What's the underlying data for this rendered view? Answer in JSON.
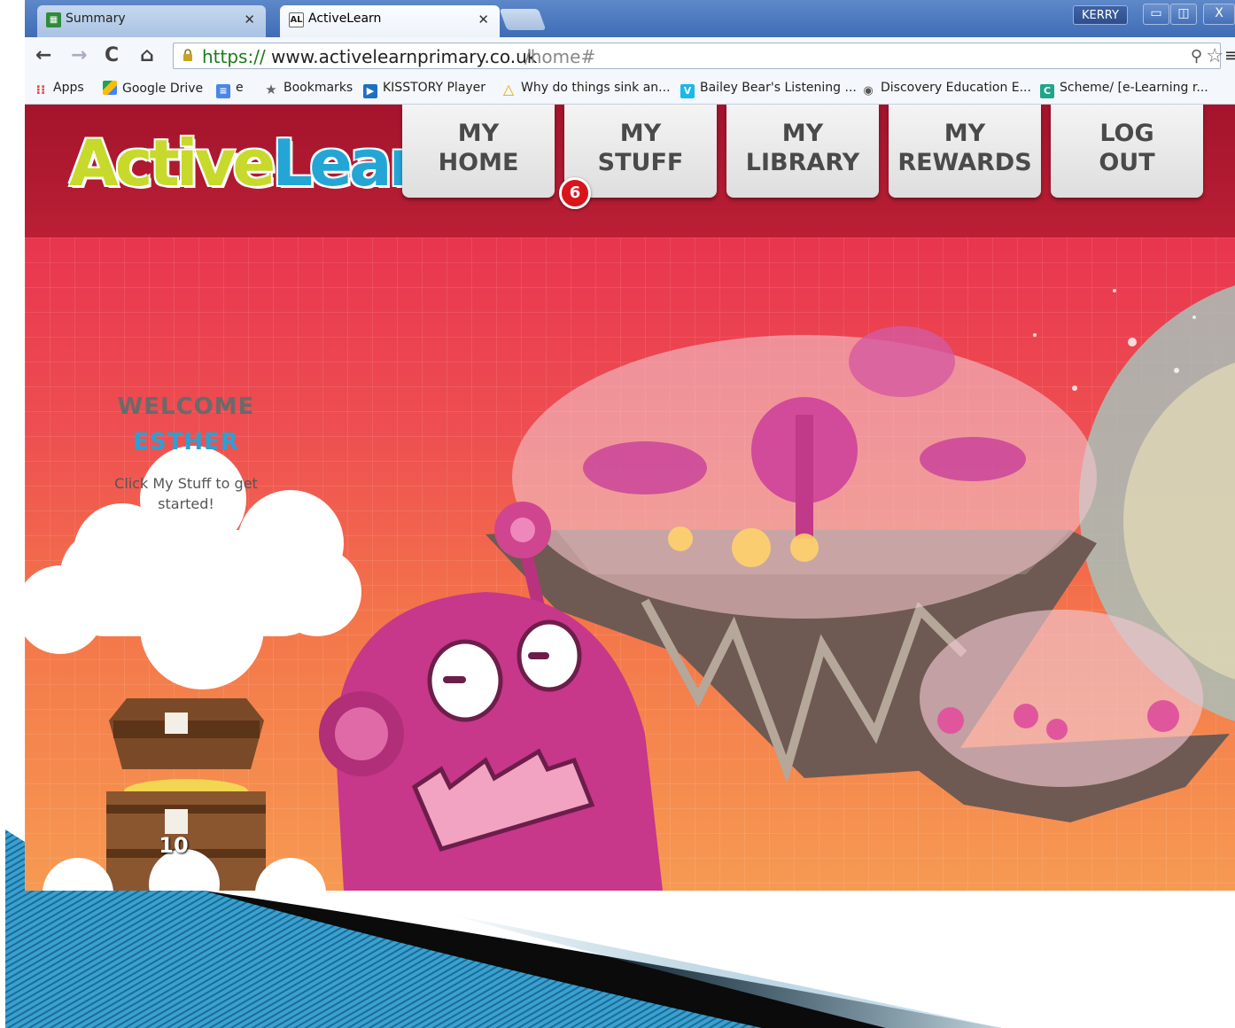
{
  "browser": {
    "tabs": [
      {
        "label": "Summary",
        "favicon": "grid-favicon",
        "active": false
      },
      {
        "label": "ActiveLearn",
        "favicon": "AL",
        "active": true
      }
    ],
    "profile": "KERRY",
    "window_controls": {
      "minimize": "▭",
      "maximize": "◫",
      "close": "X"
    },
    "url": {
      "scheme": "https://",
      "host": "www.activelearnprimary.co.uk",
      "path": "/home#"
    },
    "bookmarks": [
      {
        "label": "Apps",
        "icon": "apps-grid-icon"
      },
      {
        "label": "Google Drive",
        "icon": "google-drive-icon"
      },
      {
        "label": "e",
        "icon": "docs-icon"
      },
      {
        "label": "Bookmarks",
        "icon": "star-icon"
      },
      {
        "label": "KISSTORY Player",
        "icon": "play-icon"
      },
      {
        "label": "Why do things sink an...",
        "icon": "triangle-icon"
      },
      {
        "label": "Bailey Bear's Listening ...",
        "icon": "vimeo-icon"
      },
      {
        "label": "Discovery Education E...",
        "icon": "discovery-icon"
      },
      {
        "label": "Scheme/ [e-Learning r...",
        "icon": "scheme-icon"
      }
    ]
  },
  "site": {
    "logo": {
      "part1": "Active",
      "part2": "Learn"
    },
    "nav": [
      {
        "line1": "MY",
        "line2": "HOME"
      },
      {
        "line1": "MY",
        "line2": "STUFF"
      },
      {
        "line1": "MY",
        "line2": "LIBRARY"
      },
      {
        "line1": "MY",
        "line2": "REWARDS"
      },
      {
        "line1": "LOG",
        "line2": "OUT"
      }
    ],
    "notification_count": "6",
    "welcome": {
      "title": "WELCOME",
      "name": "ESTHER",
      "message": "Click My Stuff to get started!"
    },
    "chest_count": "10"
  },
  "colors": {
    "header_red": "#b01a30",
    "logo_green": "#c7d92b",
    "logo_blue": "#23a6d6",
    "badge_red": "#d8151d",
    "name_blue": "#2aa1d4",
    "robot_pink": "#cc3a8e"
  }
}
